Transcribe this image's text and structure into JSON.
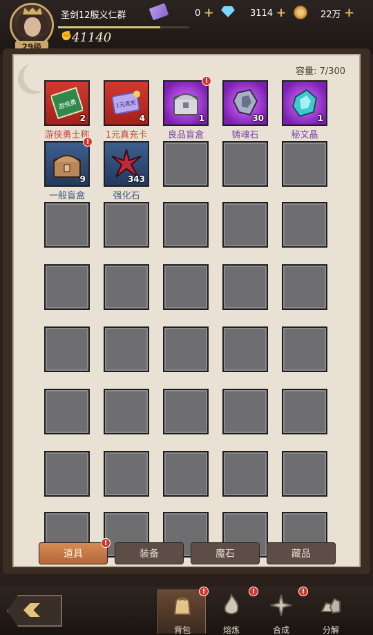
{
  "player": {
    "name": "圣剑12服义仁群",
    "level": "29级",
    "power": "41140",
    "exp_fraction": 0.78
  },
  "currencies": {
    "tickets": "0",
    "diamonds": "3114",
    "coins": "22万"
  },
  "inventory": {
    "capacity": "容量: 7/300",
    "items": [
      {
        "label": "游侠勇士称",
        "count": "2",
        "rarity": "red",
        "icon": "banner-icon",
        "art_text": "游侠勇"
      },
      {
        "label": "1元真充卡",
        "count": "4",
        "rarity": "red",
        "icon": "ticket-card-icon",
        "art_text": "1元真充"
      },
      {
        "label": "良品盲盒",
        "count": "1",
        "rarity": "purple",
        "icon": "silver-chest-icon",
        "badge": "!"
      },
      {
        "label": "铸魂石",
        "count": "30",
        "rarity": "purple",
        "icon": "soul-stone-icon"
      },
      {
        "label": "秘文晶",
        "count": "1",
        "rarity": "purple",
        "icon": "rune-crystal-icon"
      },
      {
        "label": "一般盲盒",
        "count": "9",
        "rarity": "blue",
        "icon": "wooden-chest-icon",
        "badge": "!"
      },
      {
        "label": "强化石",
        "count": "343",
        "rarity": "blue",
        "icon": "red-star-crystal-icon"
      }
    ]
  },
  "tabs": [
    {
      "label": "道具",
      "active": true,
      "badge": "!"
    },
    {
      "label": "装备",
      "active": false
    },
    {
      "label": "魔石",
      "active": false
    },
    {
      "label": "藏品",
      "active": false
    }
  ],
  "nav": [
    {
      "label": "背包",
      "icon": "bag-icon",
      "active": true,
      "badge": "!"
    },
    {
      "label": "熔炼",
      "icon": "flame-icon",
      "active": false,
      "badge": "!"
    },
    {
      "label": "合成",
      "icon": "star-compass-icon",
      "active": false,
      "badge": "!"
    },
    {
      "label": "分解",
      "icon": "rocks-icon",
      "active": false
    }
  ],
  "colors": {
    "rarity_red": "#d23a30",
    "rarity_purple": "#9b3fd0",
    "rarity_blue": "#3d5f8f",
    "panel_bg": "#e9e1d3",
    "tab_active": "#c97848"
  }
}
